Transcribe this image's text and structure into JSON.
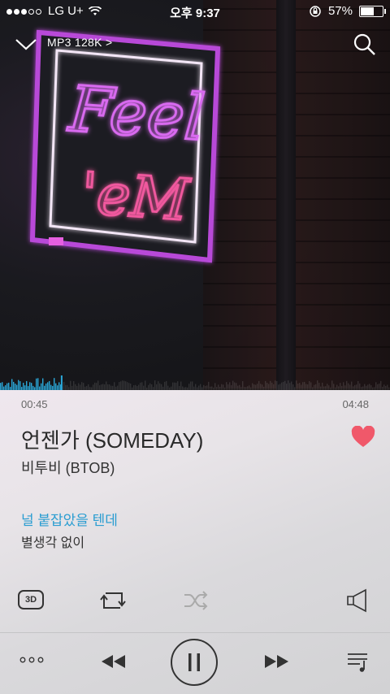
{
  "status_bar": {
    "carrier": "LG U+",
    "time": "오후 9:37",
    "battery": "57%",
    "battery_level": 0.57,
    "signal_strength": 3,
    "signal_max": 5
  },
  "header": {
    "quality_label": "MP3 128K >",
    "collapse_icon": "chevron-down-icon",
    "search_icon": "search-icon"
  },
  "album_art": {
    "sign_line1": "Feel",
    "sign_line2": "'eM"
  },
  "progress": {
    "elapsed": "00:45",
    "duration": "04:48",
    "fraction": 0.156,
    "accent_color": "#2aa7d8"
  },
  "song": {
    "title": "언젠가 (SOMEDAY)",
    "artist": "비투비 (BTOB)",
    "liked": true,
    "heart_color": "#f0586a"
  },
  "lyrics": {
    "current": "널 붙잡았을 텐데",
    "next": "별생각 없이"
  },
  "controls": {
    "effect_label": "3D",
    "repeat_icon": "repeat-icon",
    "shuffle_icon": "shuffle-icon",
    "speaker_icon": "speaker-icon",
    "more_icon": "more-icon",
    "prev_icon": "rewind-icon",
    "play_pause_icon": "pause-icon",
    "next_icon": "fast-forward-icon",
    "queue_icon": "playlist-icon"
  }
}
